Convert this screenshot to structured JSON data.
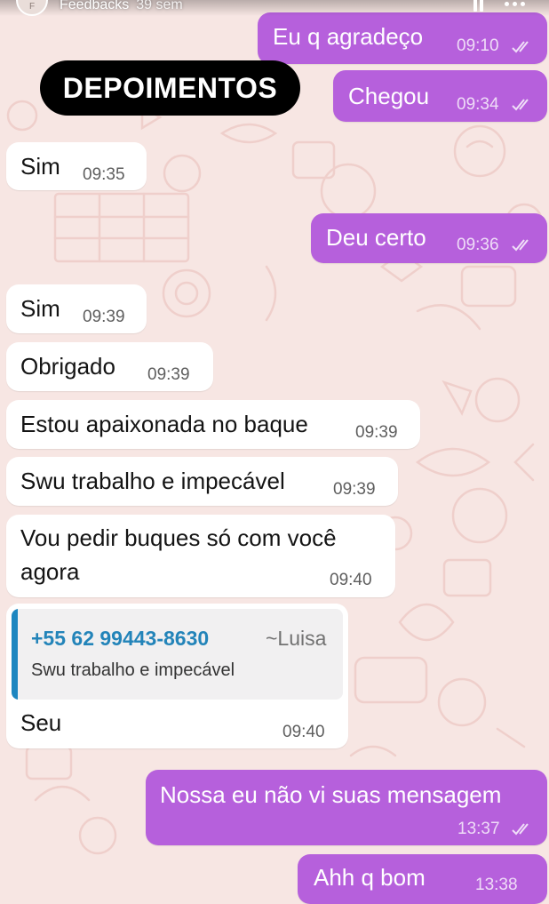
{
  "story": {
    "username": "Feedbacks",
    "age": "39 sem",
    "avatar_initial": "F"
  },
  "tag": "DEPOIMENTOS",
  "messages": [
    {
      "dir": "out",
      "text": "Eu q agradeço",
      "time": "09:10",
      "read": true
    },
    {
      "dir": "out",
      "text": "Chegou",
      "time": "09:34",
      "read": true
    },
    {
      "dir": "in",
      "text": "Sim",
      "time": "09:35"
    },
    {
      "dir": "out",
      "text": "Deu certo",
      "time": "09:36",
      "read": true
    },
    {
      "dir": "in",
      "text": "Sim",
      "time": "09:39"
    },
    {
      "dir": "in",
      "text": "Obrigado",
      "time": "09:39"
    },
    {
      "dir": "in",
      "text": "Estou apaixonada no baque",
      "time": "09:39"
    },
    {
      "dir": "in",
      "text": "Swu trabalho e impecável",
      "time": "09:39"
    },
    {
      "dir": "in",
      "text_line1": "Vou pedir buques só com você",
      "text_line2": "agora",
      "time": "09:40"
    },
    {
      "dir": "in",
      "quote": {
        "phone": "+55 62 99443-8630",
        "name": "~Luisa",
        "text": "Swu trabalho e impecável"
      },
      "text": "Seu",
      "time": "09:40"
    },
    {
      "dir": "out",
      "text": "Nossa eu não vi suas mensagem",
      "time": "13:37",
      "read": true
    },
    {
      "dir": "out",
      "text": "Ahh q bom",
      "time": "13:38"
    }
  ],
  "colors": {
    "outgoing": "#b660dc",
    "incoming": "#ffffff",
    "wallpaper": "#f7e6e3",
    "quote_accent": "#1d86c0"
  },
  "icons": [
    "pause-icon",
    "more-options-icon",
    "read-receipt-icon"
  ]
}
